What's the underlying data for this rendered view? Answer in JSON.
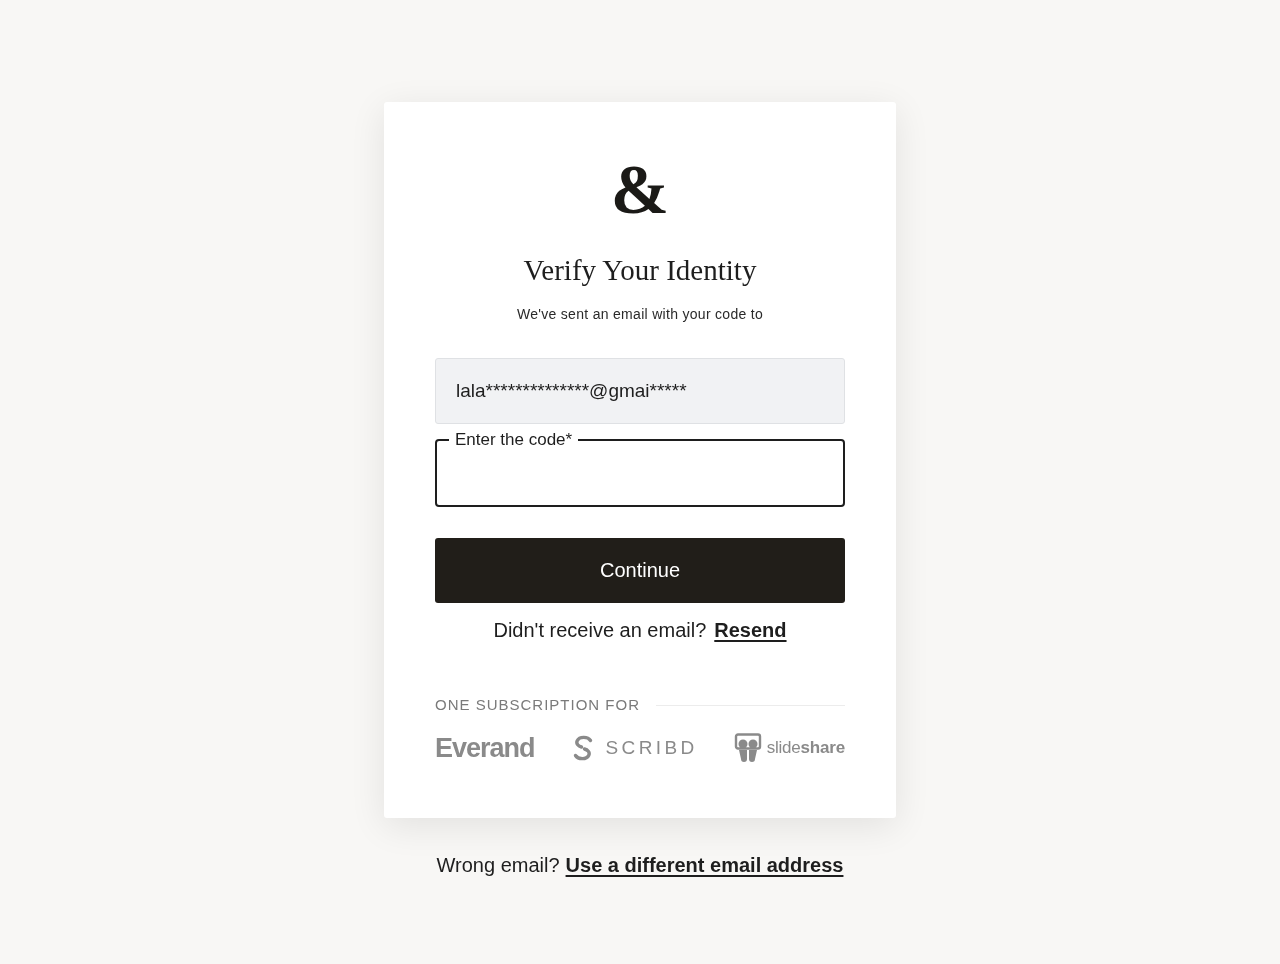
{
  "logo": "&",
  "title": "Verify Your Identity",
  "subtitle": "We've sent an email with your code to",
  "email_field": {
    "value": "lala**************@gmai*****",
    "disabled": true
  },
  "code_field": {
    "label": "Enter the code*",
    "focused": true
  },
  "continue_button": "Continue",
  "resend": {
    "text": "Didn't receive an email?",
    "link": "Resend"
  },
  "subscription": {
    "heading": "ONE SUBSCRIPTION FOR",
    "brands": [
      {
        "kind": "everand",
        "name": "Everand"
      },
      {
        "kind": "scribd",
        "name": "SCRIBD"
      },
      {
        "kind": "slideshare",
        "name": "slide**share**"
      }
    ]
  },
  "footer": {
    "text": "Wrong email?",
    "link": "Use a different email address"
  }
}
